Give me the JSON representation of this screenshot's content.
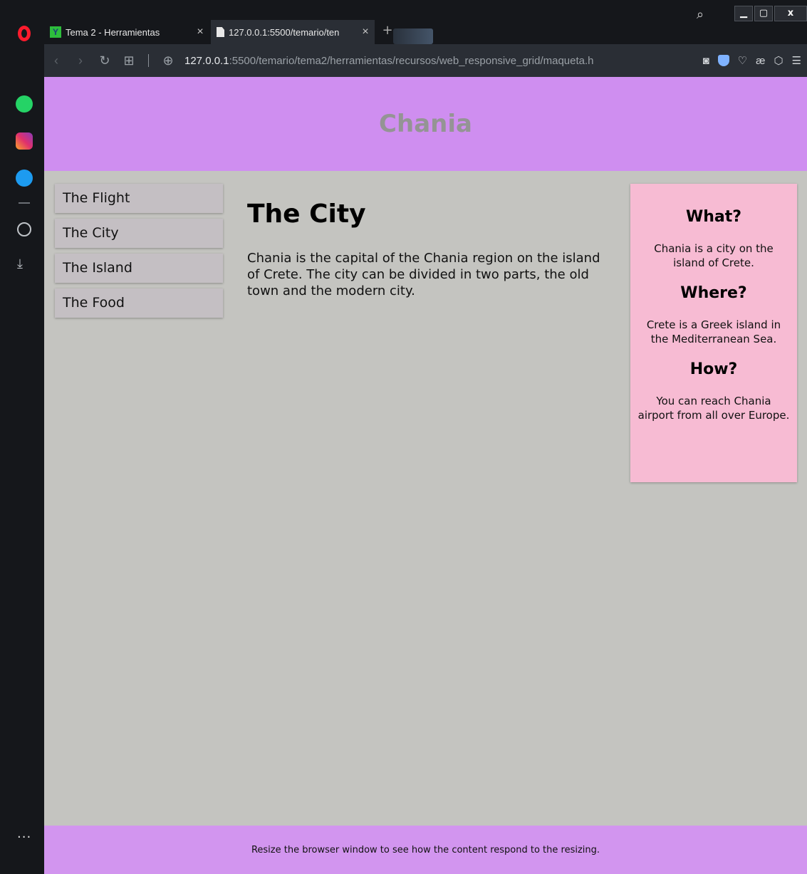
{
  "browser": {
    "tabs": [
      {
        "title": "Tema 2 - Herramientas",
        "favicon": "Y",
        "close": "×"
      },
      {
        "title": "127.0.0.1:5500/temario/ten",
        "favicon": "file-icon",
        "close": "×"
      }
    ],
    "new_tab": "+",
    "search": "⌕",
    "window": {
      "minimize": "▁",
      "maximize": "▢",
      "close": "x"
    },
    "address": {
      "host": "127.0.0.1",
      "rest": ":5500/temario/tema2/herramientas/recursos/web_responsive_grid/maqueta.h"
    },
    "sidebar_more": "···"
  },
  "page": {
    "header_title": "Chania",
    "menu": [
      "The Flight",
      "The City",
      "The Island",
      "The Food"
    ],
    "main": {
      "heading": "The City",
      "paragraph": "Chania is the capital of the Chania region on the island of Crete. The city can be divided in two parts, the old town and the modern city."
    },
    "aside": [
      {
        "heading": "What?",
        "text": "Chania is a city on the island of Crete."
      },
      {
        "heading": "Where?",
        "text": "Crete is a Greek island in the Mediterranean Sea."
      },
      {
        "heading": "How?",
        "text": "You can reach Chania airport from all over Europe."
      }
    ],
    "footer": "Resize the browser window to see how the content respond to the resizing."
  },
  "colors": {
    "header": "#cf8ef0",
    "footer": "#d295ef",
    "aside": "#f7bbd3",
    "background": "#c4c4c0",
    "menu_item": "#c4bfc3"
  }
}
